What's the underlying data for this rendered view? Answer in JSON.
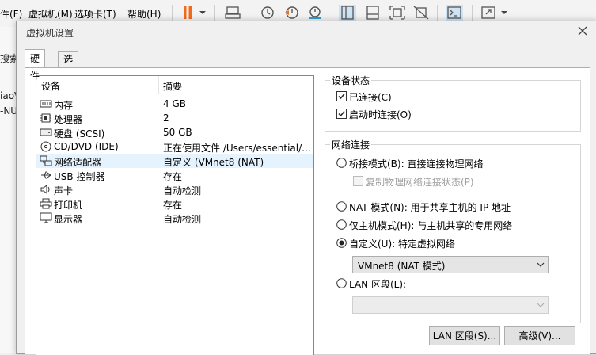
{
  "menubar": {
    "items": [
      "件(F)",
      "虚拟机(M)",
      "选项卡(T)",
      "帮助(H)"
    ]
  },
  "toolbar": {
    "icons": [
      "pause-icon",
      "send-keys-icon",
      "snapshot-icon",
      "revert-snapshot-icon",
      "snapshot-manager-icon",
      "view-console-icon",
      "view-thumbnail-icon",
      "fit-window-icon",
      "unity-icon",
      "terminal-icon",
      "fullscreen-icon"
    ],
    "pause_color": "#f26b1d"
  },
  "background_fragments": {
    "search_label": "搜索",
    "vm_name_fragment": "iaoV",
    "other_fragment": "-NU"
  },
  "dialog": {
    "title": "虚拟机设置",
    "tabs": [
      {
        "label": "硬件",
        "active": true
      },
      {
        "label": "选项",
        "active": false
      }
    ],
    "device_list": {
      "col_device": "设备",
      "col_summary": "摘要",
      "rows": [
        {
          "icon": "memory-icon",
          "name": "内存",
          "summary": "4 GB",
          "selected": false
        },
        {
          "icon": "processor-icon",
          "name": "处理器",
          "summary": "2",
          "selected": false
        },
        {
          "icon": "hard-disk-icon",
          "name": "硬盘 (SCSI)",
          "summary": "50 GB",
          "selected": false
        },
        {
          "icon": "cd-dvd-icon",
          "name": "CD/DVD (IDE)",
          "summary": "正在使用文件 /Users/essential/...",
          "selected": false
        },
        {
          "icon": "network-adapter-icon",
          "name": "网络适配器",
          "summary": "自定义 (VMnet8 (NAT)",
          "selected": true
        },
        {
          "icon": "usb-icon",
          "name": "USB 控制器",
          "summary": "存在",
          "selected": false
        },
        {
          "icon": "sound-card-icon",
          "name": "声卡",
          "summary": "自动检测",
          "selected": false
        },
        {
          "icon": "printer-icon",
          "name": "打印机",
          "summary": "存在",
          "selected": false
        },
        {
          "icon": "display-icon",
          "name": "显示器",
          "summary": "自动检测",
          "selected": false
        }
      ]
    },
    "device_status": {
      "legend": "设备状态",
      "connected": {
        "label": "已连接(C)",
        "checked": true
      },
      "connect_at_power_on": {
        "label": "启动时连接(O)",
        "checked": true
      }
    },
    "network_connection": {
      "legend": "网络连接",
      "bridged": {
        "label": "桥接模式(B): 直接连接物理网络",
        "checked": false
      },
      "replicate": {
        "label": "复制物理网络连接状态(P)",
        "checked": false,
        "disabled": true
      },
      "nat": {
        "label": "NAT 模式(N): 用于共享主机的 IP 地址",
        "checked": false
      },
      "host_only": {
        "label": "仅主机模式(H): 与主机共享的专用网络",
        "checked": false
      },
      "custom": {
        "label": "自定义(U): 特定虚拟网络",
        "checked": true
      },
      "custom_select": "VMnet8 (NAT 模式)",
      "lan_segment": {
        "label": "LAN 区段(L):",
        "checked": false
      },
      "lan_select": ""
    },
    "buttons": {
      "lan_segments": "LAN 区段(S)...",
      "advanced": "高级(V)..."
    }
  }
}
